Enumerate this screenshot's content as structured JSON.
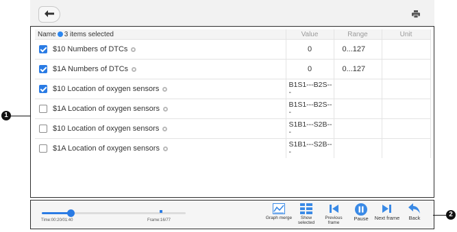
{
  "header": {
    "back_icon": "back-arrow-icon",
    "print_icon": "print-icon"
  },
  "table": {
    "columns": {
      "name": "Name",
      "selected_count": "3 items selected",
      "value": "Value",
      "range": "Range",
      "unit": "Unit"
    },
    "rows": [
      {
        "name": "$10 Numbers of DTCs",
        "checked": true,
        "value": "0",
        "range": "0...127",
        "unit": ""
      },
      {
        "name": "$1A Numbers of DTCs",
        "checked": true,
        "value": "0",
        "range": "0...127",
        "unit": ""
      },
      {
        "name": "$10 Location of oxygen sensors",
        "checked": true,
        "value": "B1S1---B2S--\n-",
        "range": "",
        "unit": ""
      },
      {
        "name": "$1A Location of oxygen sensors",
        "checked": false,
        "value": "B1S1---B2S--\n-",
        "range": "",
        "unit": ""
      },
      {
        "name": "$10 Location of oxygen sensors",
        "checked": false,
        "value": "S1B1---S2B--\n-",
        "range": "",
        "unit": ""
      },
      {
        "name": "$1A Location of oxygen sensors",
        "checked": false,
        "value": "S1B1---S2B--\n-",
        "range": "",
        "unit": ""
      }
    ]
  },
  "playback": {
    "time": "Time:00:20/01:40",
    "frame": "Frame:16/77",
    "progress": 0.2,
    "buttons": {
      "graph_merge": "Graph merge",
      "show_selected": "Show selected",
      "previous_frame": "Previous frame",
      "pause": "Pause",
      "next_frame": "Next frame",
      "back": "Back"
    }
  },
  "callouts": {
    "one": "1",
    "two": "2"
  },
  "colors": {
    "accent": "#2a7be4",
    "selected_dot": "#2a86f0"
  }
}
